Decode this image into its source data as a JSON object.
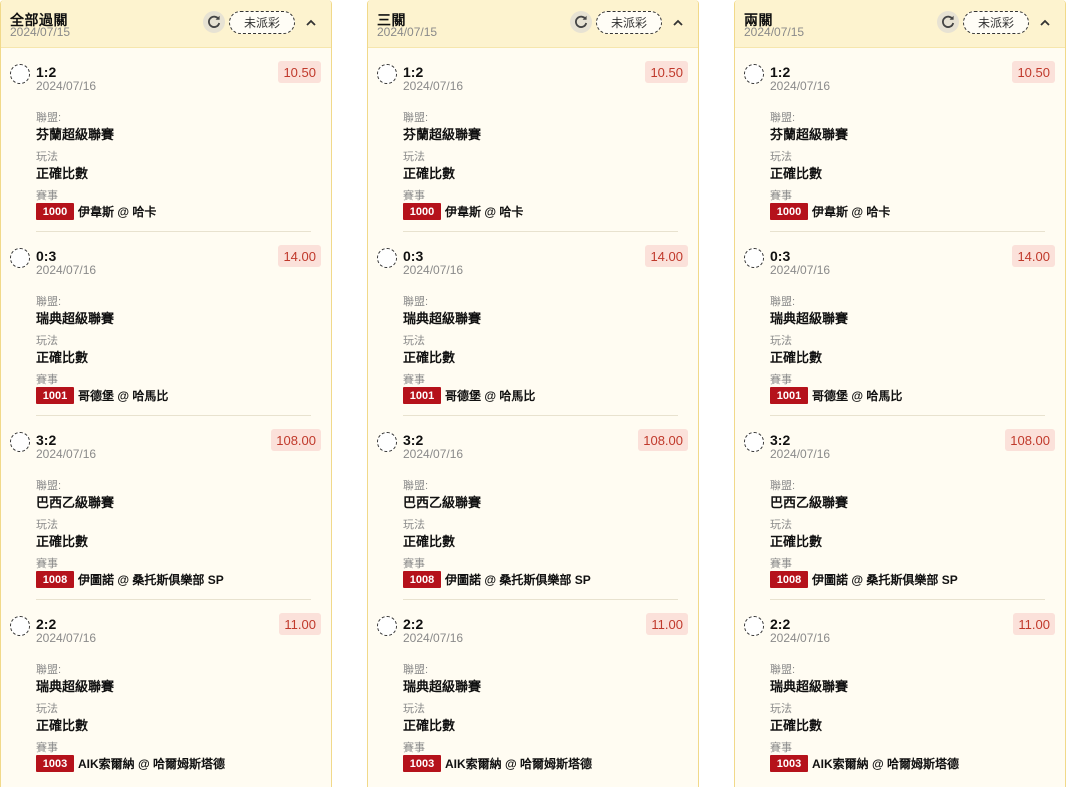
{
  "status_label": "未派彩",
  "colors": {
    "header_bg": "#fdf3cf",
    "panel_bg": "#fffcf2",
    "odds_bg": "#fbe1da",
    "odds_text": "#c0392b",
    "code_bg": "#b5121b"
  },
  "field_labels": {
    "league": "聯盟:",
    "play": "玩法",
    "match": "賽事"
  },
  "panels": [
    {
      "title": "全部過關",
      "date": "2024/07/15",
      "bets": [
        {
          "score": "1:2",
          "date": "2024/07/16",
          "odds": "10.50",
          "league": "芬蘭超級聯賽",
          "play": "正確比數",
          "code": "1000",
          "match": "伊韋斯 @ 哈卡"
        },
        {
          "score": "0:3",
          "date": "2024/07/16",
          "odds": "14.00",
          "league": "瑞典超級聯賽",
          "play": "正確比數",
          "code": "1001",
          "match": "哥德堡 @ 哈馬比"
        },
        {
          "score": "3:2",
          "date": "2024/07/16",
          "odds": "108.00",
          "league": "巴西乙級聯賽",
          "play": "正確比數",
          "code": "1008",
          "match": "伊圖諾 @ 桑托斯俱樂部 SP"
        },
        {
          "score": "2:2",
          "date": "2024/07/16",
          "odds": "11.00",
          "league": "瑞典超級聯賽",
          "play": "正確比數",
          "code": "1003",
          "match": "AIK索爾納 @ 哈爾姆斯塔德"
        }
      ]
    },
    {
      "title": "三關",
      "date": "2024/07/15",
      "bets": [
        {
          "score": "1:2",
          "date": "2024/07/16",
          "odds": "10.50",
          "league": "芬蘭超級聯賽",
          "play": "正確比數",
          "code": "1000",
          "match": "伊韋斯 @ 哈卡"
        },
        {
          "score": "0:3",
          "date": "2024/07/16",
          "odds": "14.00",
          "league": "瑞典超級聯賽",
          "play": "正確比數",
          "code": "1001",
          "match": "哥德堡 @ 哈馬比"
        },
        {
          "score": "3:2",
          "date": "2024/07/16",
          "odds": "108.00",
          "league": "巴西乙級聯賽",
          "play": "正確比數",
          "code": "1008",
          "match": "伊圖諾 @ 桑托斯俱樂部 SP"
        },
        {
          "score": "2:2",
          "date": "2024/07/16",
          "odds": "11.00",
          "league": "瑞典超級聯賽",
          "play": "正確比數",
          "code": "1003",
          "match": "AIK索爾納 @ 哈爾姆斯塔德"
        }
      ]
    },
    {
      "title": "兩關",
      "date": "2024/07/15",
      "bets": [
        {
          "score": "1:2",
          "date": "2024/07/16",
          "odds": "10.50",
          "league": "芬蘭超級聯賽",
          "play": "正確比數",
          "code": "1000",
          "match": "伊韋斯 @ 哈卡"
        },
        {
          "score": "0:3",
          "date": "2024/07/16",
          "odds": "14.00",
          "league": "瑞典超級聯賽",
          "play": "正確比數",
          "code": "1001",
          "match": "哥德堡 @ 哈馬比"
        },
        {
          "score": "3:2",
          "date": "2024/07/16",
          "odds": "108.00",
          "league": "巴西乙級聯賽",
          "play": "正確比數",
          "code": "1008",
          "match": "伊圖諾 @ 桑托斯俱樂部 SP"
        },
        {
          "score": "2:2",
          "date": "2024/07/16",
          "odds": "11.00",
          "league": "瑞典超級聯賽",
          "play": "正確比數",
          "code": "1003",
          "match": "AIK索爾納 @ 哈爾姆斯塔德"
        }
      ]
    }
  ]
}
